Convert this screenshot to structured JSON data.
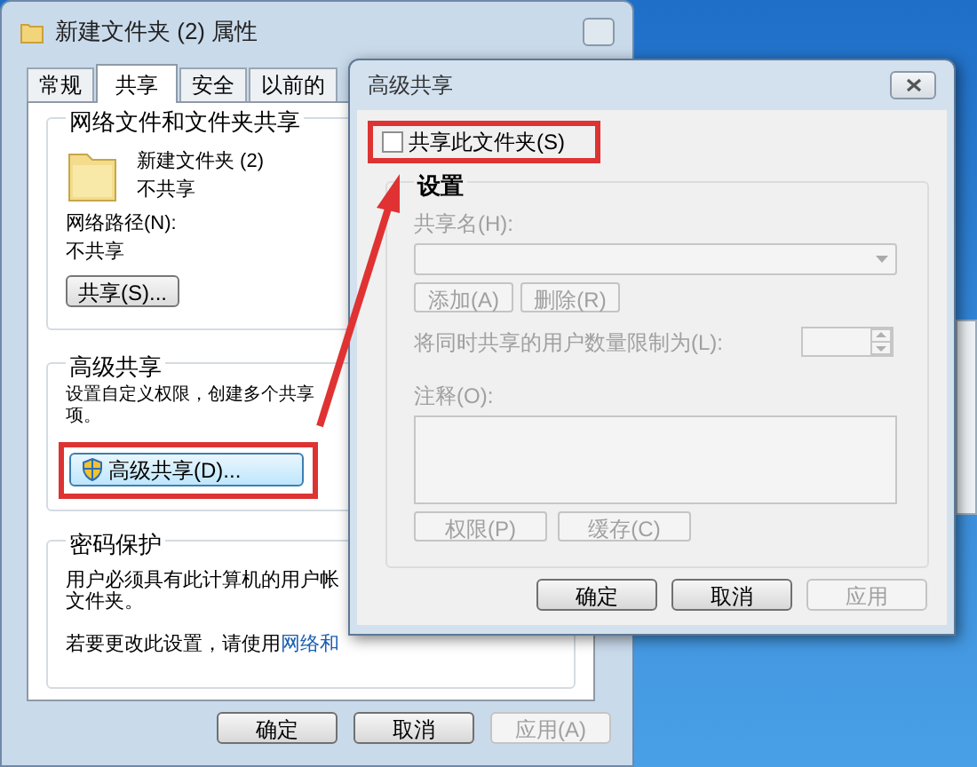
{
  "properties_window": {
    "title": "新建文件夹 (2) 属性",
    "tabs": [
      {
        "label": "常规",
        "selected": false
      },
      {
        "label": "共享",
        "selected": true
      },
      {
        "label": "安全",
        "selected": false
      },
      {
        "label": "以前的",
        "selected": false
      }
    ],
    "network_sharing": {
      "heading": "网络文件和文件夹共享",
      "folder_name": "新建文件夹 (2)",
      "folder_status": "不共享",
      "path_label": "网络路径(N):",
      "path_value": "不共享",
      "share_button": {
        "label": "共享(S)...",
        "disabled": false
      }
    },
    "advanced_sharing": {
      "heading": "高级共享",
      "description_lines": [
        "设置自定义权限，创建多个共享",
        "项。"
      ],
      "button": {
        "label": "高级共享(D)...",
        "disabled": false
      }
    },
    "password_protection": {
      "heading": "密码保护",
      "description_lines": [
        "用户必须具有此计算机的用户帐",
        "文件夹。"
      ],
      "change_text": "若要更改此设置，请使用",
      "link": "网络和"
    },
    "buttons": [
      {
        "label": "确定",
        "disabled": false
      },
      {
        "label": "取消",
        "disabled": false
      },
      {
        "label": "应用(A)",
        "disabled": true
      }
    ]
  },
  "advanced_sharing_dialog": {
    "title": "高级共享",
    "share_checkbox": {
      "label": "共享此文件夹(S)",
      "checked": false
    },
    "settings": {
      "heading": "设置",
      "share_name_label": "共享名(H):",
      "add_button": "添加(A)",
      "remove_button": "删除(R)",
      "limit_label": "将同时共享的用户数量限制为(L):",
      "comment_label": "注释(O):",
      "permissions_button": "权限(P)",
      "cache_button": "缓存(C)"
    },
    "buttons": [
      {
        "label": "确定",
        "disabled": false
      },
      {
        "label": "取消",
        "disabled": false
      },
      {
        "label": "应用",
        "disabled": true
      }
    ]
  }
}
